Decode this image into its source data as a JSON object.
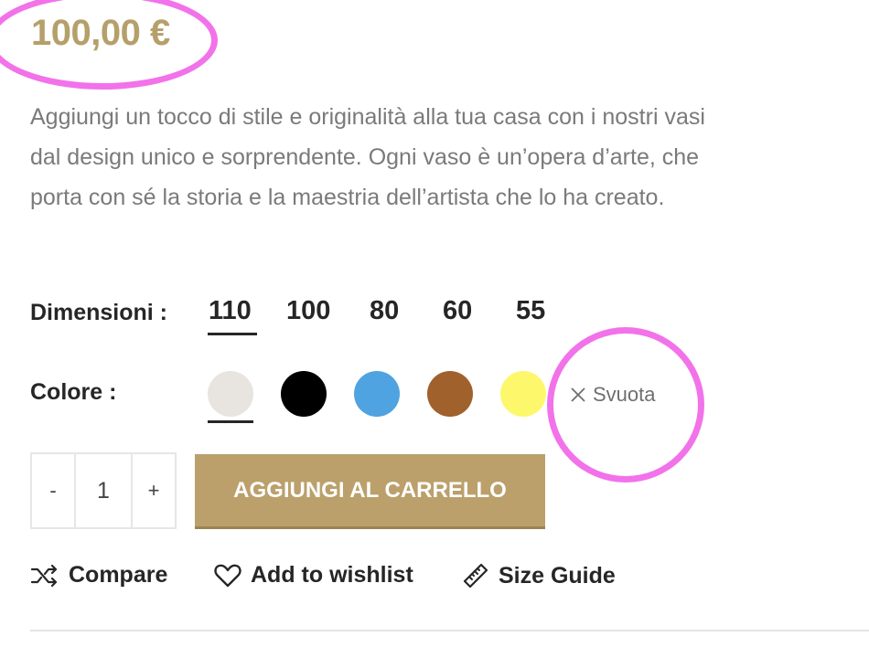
{
  "product": {
    "price": "100,00 €",
    "description": "Aggiungi un tocco di stile e originalità alla tua casa con i nostri vasi dal design unico e sorprendente. Ogni vaso è un’opera d’arte, che porta con sé la storia e la maestria dell’artista che lo ha creato."
  },
  "variations": {
    "size_label": "Dimensioni :",
    "sizes": [
      "110",
      "100",
      "80",
      "60",
      "55"
    ],
    "selected_size": "110",
    "color_label": "Colore :",
    "colors": [
      "#e8e5e0",
      "#000000",
      "#4fa3e0",
      "#a0612d",
      "#fdf86b"
    ],
    "selected_color": "#e8e5e0",
    "reset_label": "Svuota"
  },
  "cart": {
    "minus": "-",
    "quantity": "1",
    "plus": "+",
    "add_label": "AGGIUNGI AL CARRELLO"
  },
  "actions": {
    "compare": "Compare",
    "wishlist": "Add to wishlist",
    "size_guide": "Size Guide"
  },
  "annotation_color": "#f272ea"
}
